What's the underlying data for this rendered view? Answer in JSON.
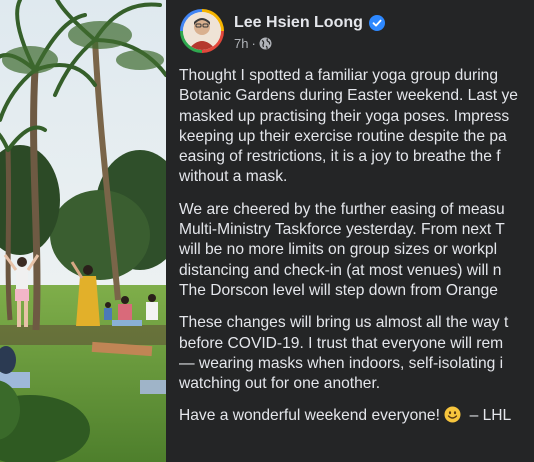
{
  "post": {
    "author": "Lee Hsien Loong",
    "timestamp": "7h",
    "meta_separator": "·",
    "verified_icon": "verified-badge-icon",
    "audience_icon": "globe-icon",
    "paragraphs": [
      [
        "Thought I spotted a familiar yoga group during",
        "Botanic Gardens during Easter weekend. Last ye",
        "masked up practising their yoga poses. Impress",
        "keeping up their exercise routine despite the pa",
        "easing of restrictions, it is a joy to breathe the f",
        "without a mask."
      ],
      [
        "We are cheered by the further easing of measu",
        "Multi-Ministry Taskforce yesterday. From next T",
        "will be no more limits on group sizes or workpl",
        "distancing and check-in (at most venues) will n",
        "The Dorscon level will step down from Orange"
      ],
      [
        "These changes will bring us almost all the way t",
        "before COVID-19. I trust that everyone will rem",
        "— wearing masks when indoors, self-isolating i",
        "watching out for one another."
      ]
    ],
    "closing_before_emoji": "Have a wonderful weekend everyone!",
    "closing_after_emoji": "– LHL",
    "closing_emoji": "smiling-face-icon"
  },
  "colors": {
    "panel_bg": "#242526",
    "text_primary": "#e4e6eb",
    "text_secondary": "#b0b3b8",
    "verified_blue": "#2d88ff"
  }
}
